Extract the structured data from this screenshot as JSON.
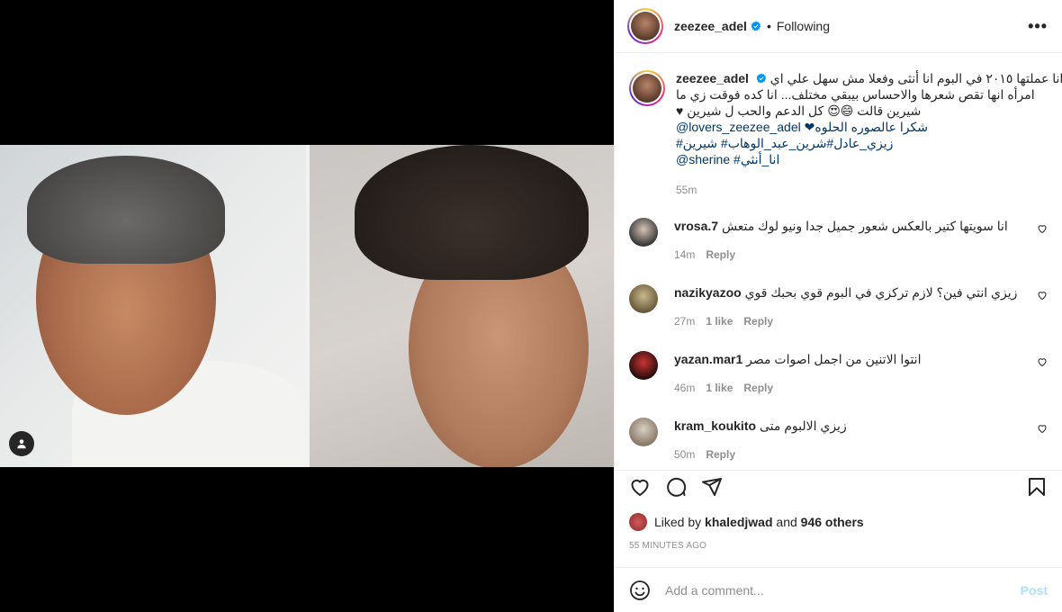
{
  "header": {
    "username": "zeezee_adel",
    "separator": "•",
    "follow_status": "Following",
    "more_label": "•••"
  },
  "caption": {
    "username": "zeezee_adel",
    "lines": [
      "انا عملتها ٢٠١٥ في البوم انا أنثى وفعلا مش سهل علي اي",
      "امرأه انها تقص شعرها والاحساس بيبقي مختلف... انا كده فوقت زي ما",
      "♥ شيرين قالت 😄😍 كل الدعم والحب ل شيرين",
      "@lovers_zeezee_adel ❤شكرا عالصوره الحلوه",
      "#زيزي_عادل#شرين_عبد_الوهاب# شيرين",
      "@sherine #انا_أنثي"
    ],
    "time": "55m"
  },
  "comments": [
    {
      "username": "vrosa.7",
      "text": "انا سويتها كتير بالعكس شعور جميل جدا ونيو لوك متعش",
      "time": "14m",
      "likes": "",
      "reply": "Reply",
      "avatar_color": "#3a3a3a"
    },
    {
      "username": "nazikyazoo",
      "text": "زيزي انتي فين؟ لازم تركزي في البوم قوي بحبك قوي",
      "time": "27m",
      "likes": "1 like",
      "reply": "Reply",
      "avatar_color": "#6b5a3a"
    },
    {
      "username": "yazan.mar1",
      "text": "انتوا الاتنين من اجمل اصوات مصر",
      "time": "46m",
      "likes": "1 like",
      "reply": "Reply",
      "avatar_color": "#5a1c1c"
    },
    {
      "username": "kram_koukito",
      "text": "زيزي الالبوم متى",
      "time": "50m",
      "likes": "",
      "reply": "Reply",
      "avatar_color": "#8a7a6a"
    }
  ],
  "likes": {
    "prefix": "Liked by",
    "user": "khaledjwad",
    "middle": "and",
    "others": "946 others"
  },
  "posted_ago": "55 MINUTES AGO",
  "add_comment": {
    "placeholder": "Add a comment...",
    "post_label": "Post"
  },
  "colors": {
    "link": "#00376b",
    "muted": "#8e8e8e",
    "verified": "#0095f6",
    "post_disabled": "#b2dffc"
  },
  "icons": [
    "heart-icon",
    "comment-icon",
    "share-icon",
    "save-icon",
    "emoji-icon",
    "verified-icon",
    "user-tag-icon"
  ]
}
